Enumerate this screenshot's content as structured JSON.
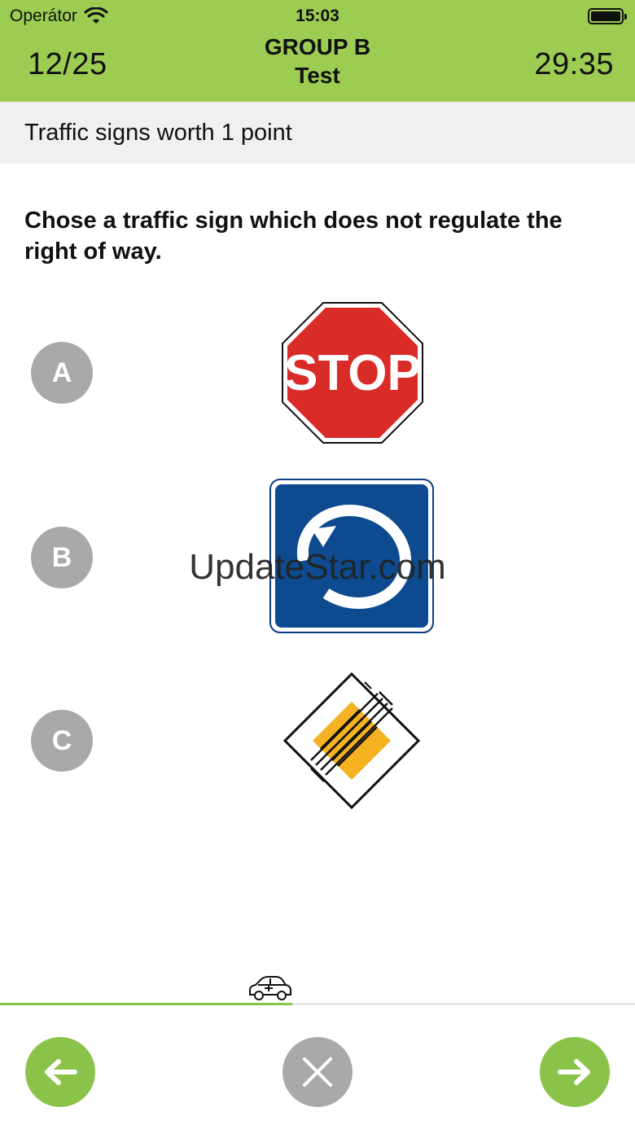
{
  "status_bar": {
    "carrier": "Operátor",
    "time": "15:03"
  },
  "header": {
    "counter": "12/25",
    "group": "GROUP B",
    "subtitle": "Test",
    "timer": "29:35"
  },
  "category": "Traffic signs worth 1 point",
  "question": "Chose a traffic sign which does not regulate the right of way.",
  "options": [
    {
      "letter": "A",
      "sign": "stop-sign",
      "sign_text": "STOP"
    },
    {
      "letter": "B",
      "sign": "roundabout-sign"
    },
    {
      "letter": "C",
      "sign": "end-of-priority-road-sign"
    }
  ],
  "watermark": "UpdateStar.com",
  "progress": {
    "current": 12,
    "total": 25
  },
  "icons": {
    "prev": "arrow-left-icon",
    "close": "close-icon",
    "next": "arrow-right-icon",
    "progress": "car-icon"
  },
  "colors": {
    "accent": "#9ccc52",
    "button_green": "#8bc34a",
    "option_gray": "#a9a9a9"
  }
}
